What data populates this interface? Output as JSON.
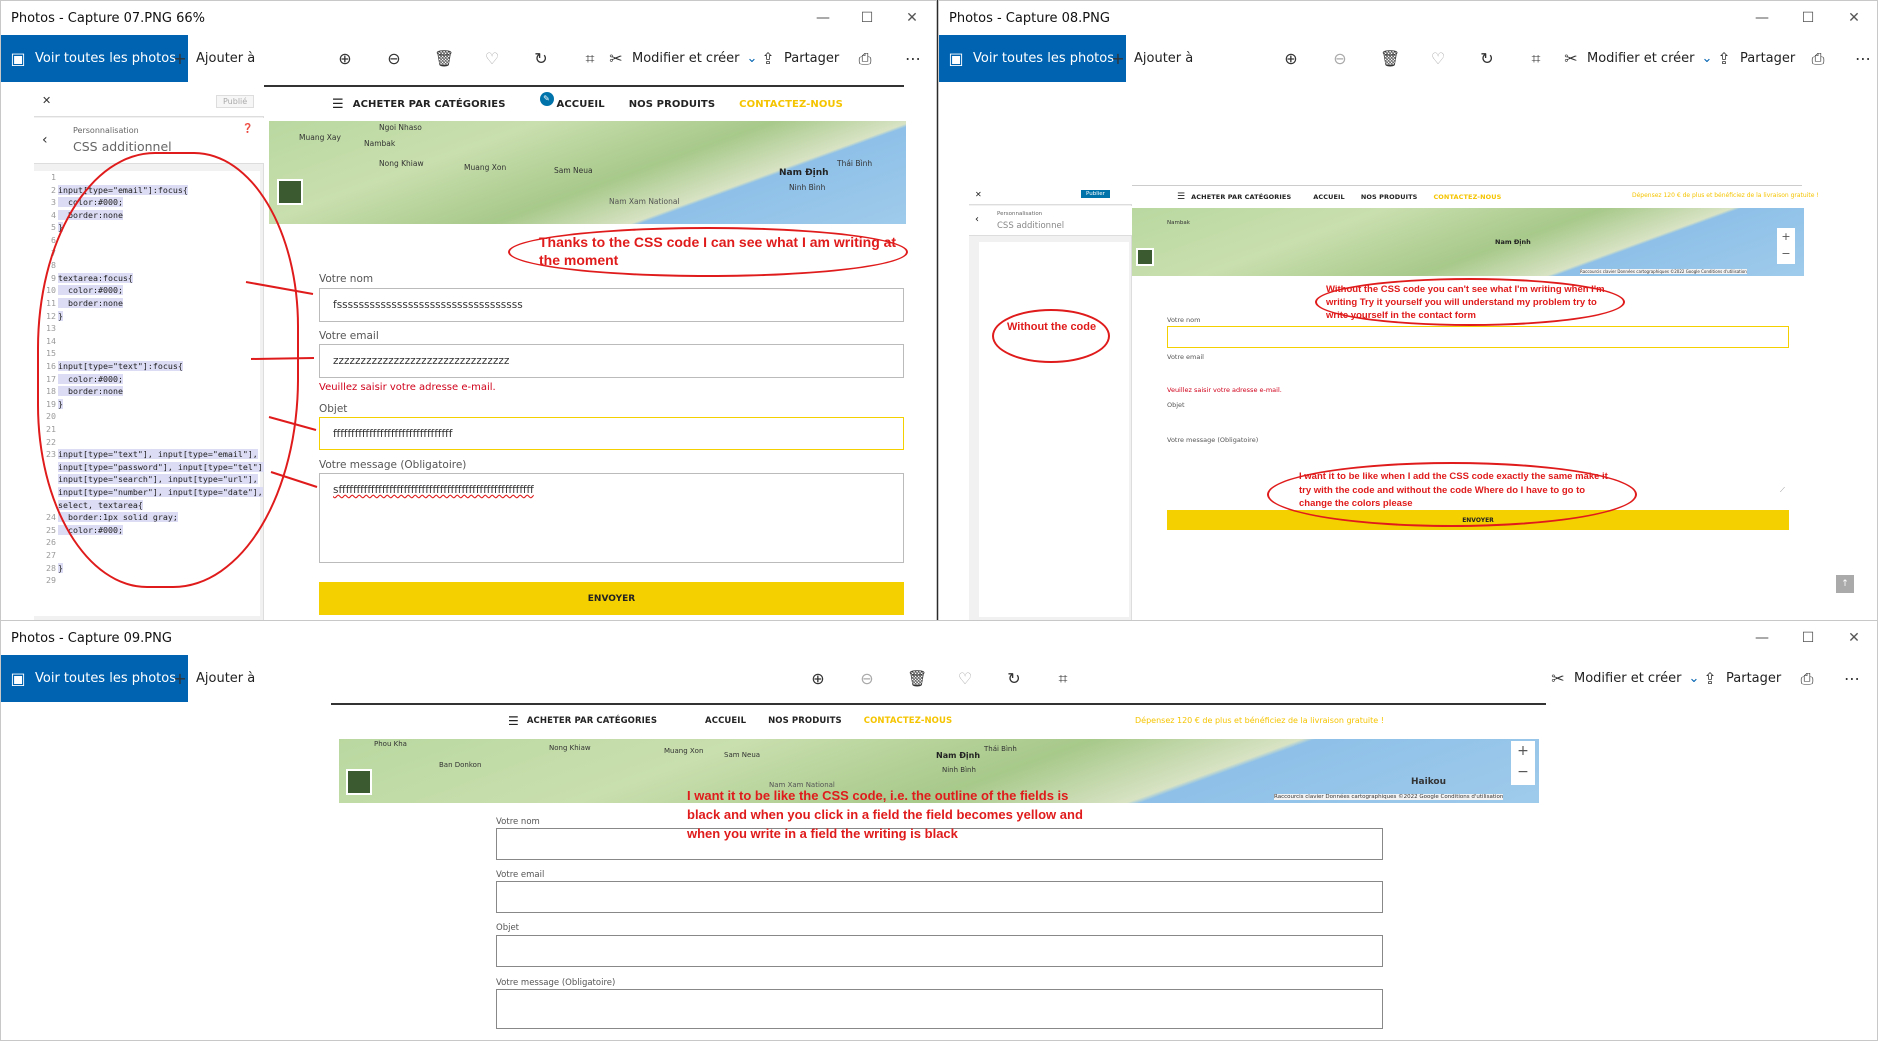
{
  "win1": {
    "title": "Photos - Capture 07.PNG   66%",
    "see_all": "Voir toutes les photos",
    "add_to": "Ajouter à",
    "edit_create": "Modifier et créer",
    "share": "Partager"
  },
  "win2": {
    "title": "Photos - Capture 08.PNG",
    "see_all": "Voir toutes les photos",
    "add_to": "Ajouter à",
    "edit_create": "Modifier et créer",
    "share": "Partager"
  },
  "win3": {
    "title": "Photos - Capture 09.PNG",
    "see_all": "Voir toutes les photos",
    "add_to": "Ajouter à",
    "edit_create": "Modifier et créer",
    "share": "Partager"
  },
  "customizer": {
    "published": "Publié",
    "publish": "Publier",
    "section_parent": "Personnalisation",
    "section_title": "CSS additionnel",
    "code": [
      {
        "n": "1",
        "t": ""
      },
      {
        "n": "2",
        "t": "input[type=\"email\"]:focus{"
      },
      {
        "n": "3",
        "t": "  color:#000;"
      },
      {
        "n": "4",
        "t": "  border:none"
      },
      {
        "n": "5",
        "t": "}"
      },
      {
        "n": "6",
        "t": ""
      },
      {
        "n": "7",
        "t": ""
      },
      {
        "n": "8",
        "t": ""
      },
      {
        "n": "9",
        "t": "textarea:focus{"
      },
      {
        "n": "10",
        "t": "  color:#000;"
      },
      {
        "n": "11",
        "t": "  border:none"
      },
      {
        "n": "12",
        "t": "}"
      },
      {
        "n": "13",
        "t": ""
      },
      {
        "n": "14",
        "t": ""
      },
      {
        "n": "15",
        "t": ""
      },
      {
        "n": "16",
        "t": "input[type=\"text\"]:focus{"
      },
      {
        "n": "17",
        "t": "  color:#000;"
      },
      {
        "n": "18",
        "t": "  border:none"
      },
      {
        "n": "19",
        "t": "}"
      },
      {
        "n": "20",
        "t": ""
      },
      {
        "n": "21",
        "t": ""
      },
      {
        "n": "22",
        "t": ""
      },
      {
        "n": "23",
        "t": "input[type=\"text\"], input[type=\"email\"],"
      },
      {
        "n": "",
        "t": "input[type=\"password\"], input[type=\"tel\"],"
      },
      {
        "n": "",
        "t": "input[type=\"search\"], input[type=\"url\"],"
      },
      {
        "n": "",
        "t": "input[type=\"number\"], input[type=\"date\"],"
      },
      {
        "n": "",
        "t": "select, textarea{"
      },
      {
        "n": "24",
        "t": "  border:1px solid gray;"
      },
      {
        "n": "25",
        "t": "  color:#000;"
      },
      {
        "n": "26",
        "t": ""
      },
      {
        "n": "27",
        "t": ""
      },
      {
        "n": "28",
        "t": "}"
      },
      {
        "n": "29",
        "t": ""
      }
    ]
  },
  "site": {
    "nav_categories": "ACHETER PAR CATÉGORIES",
    "nav_home": "ACCUEIL",
    "nav_products": "NOS PRODUITS",
    "nav_contact": "CONTACTEZ-NOUS",
    "promo": "Dépensez 120 € de plus et bénéficiez de la livraison gratuite !",
    "label_name": "Votre nom",
    "label_email": "Votre email",
    "label_subject": "Objet",
    "label_message": "Votre message (Obligatoire)",
    "value_name": "fssssssssssssssssssssssssssssssssss",
    "value_email": "zzzzzzzzzzzzzzzzzzzzzzzzzzzzzzzz",
    "value_subject": "fffffffffffffffffffffffffffffffff",
    "value_message": "sffffffffffffffffffffffffffffffffffffffffffffffffffffff",
    "email_error": "Veuillez saisir votre adresse e-mail.",
    "send": "ENVOYER",
    "map_places": [
      "Muang Xay",
      "Ngoi Nhaso",
      "Nambak",
      "Nong Khiaw",
      "Muang Xon",
      "Sam Neua",
      "Nam Định",
      "Thái Bình",
      "Ninh Bình",
      "Ban Donkon",
      "Phou Kha",
      "Haikou",
      "Nam Xam National"
    ],
    "map_credits": "Raccourcis clavier   Données cartographiques ©2022 Google   Conditions d'utilisation"
  },
  "notes": {
    "n1": "Thanks to the CSS code I can see what I am writing at the moment",
    "n2": "Without the code",
    "n3": "Without the CSS code you can't see what I'm writing when I'm writing Try it yourself you will understand my problem try to write yourself in the contact form",
    "n4": "I want it to be like when I add the CSS code exactly the same make it try with the code and without the code Where do I have to go to change the colors please",
    "n5": "I want it to be like the CSS code, i.e. the outline of the fields is black and when you click in a field the field becomes yellow and when you write in a field the writing is black"
  },
  "colors": {
    "accent": "#0063b1",
    "yellow": "#f5d000",
    "annotation": "#e01b1b",
    "contact": "#f5c400"
  }
}
